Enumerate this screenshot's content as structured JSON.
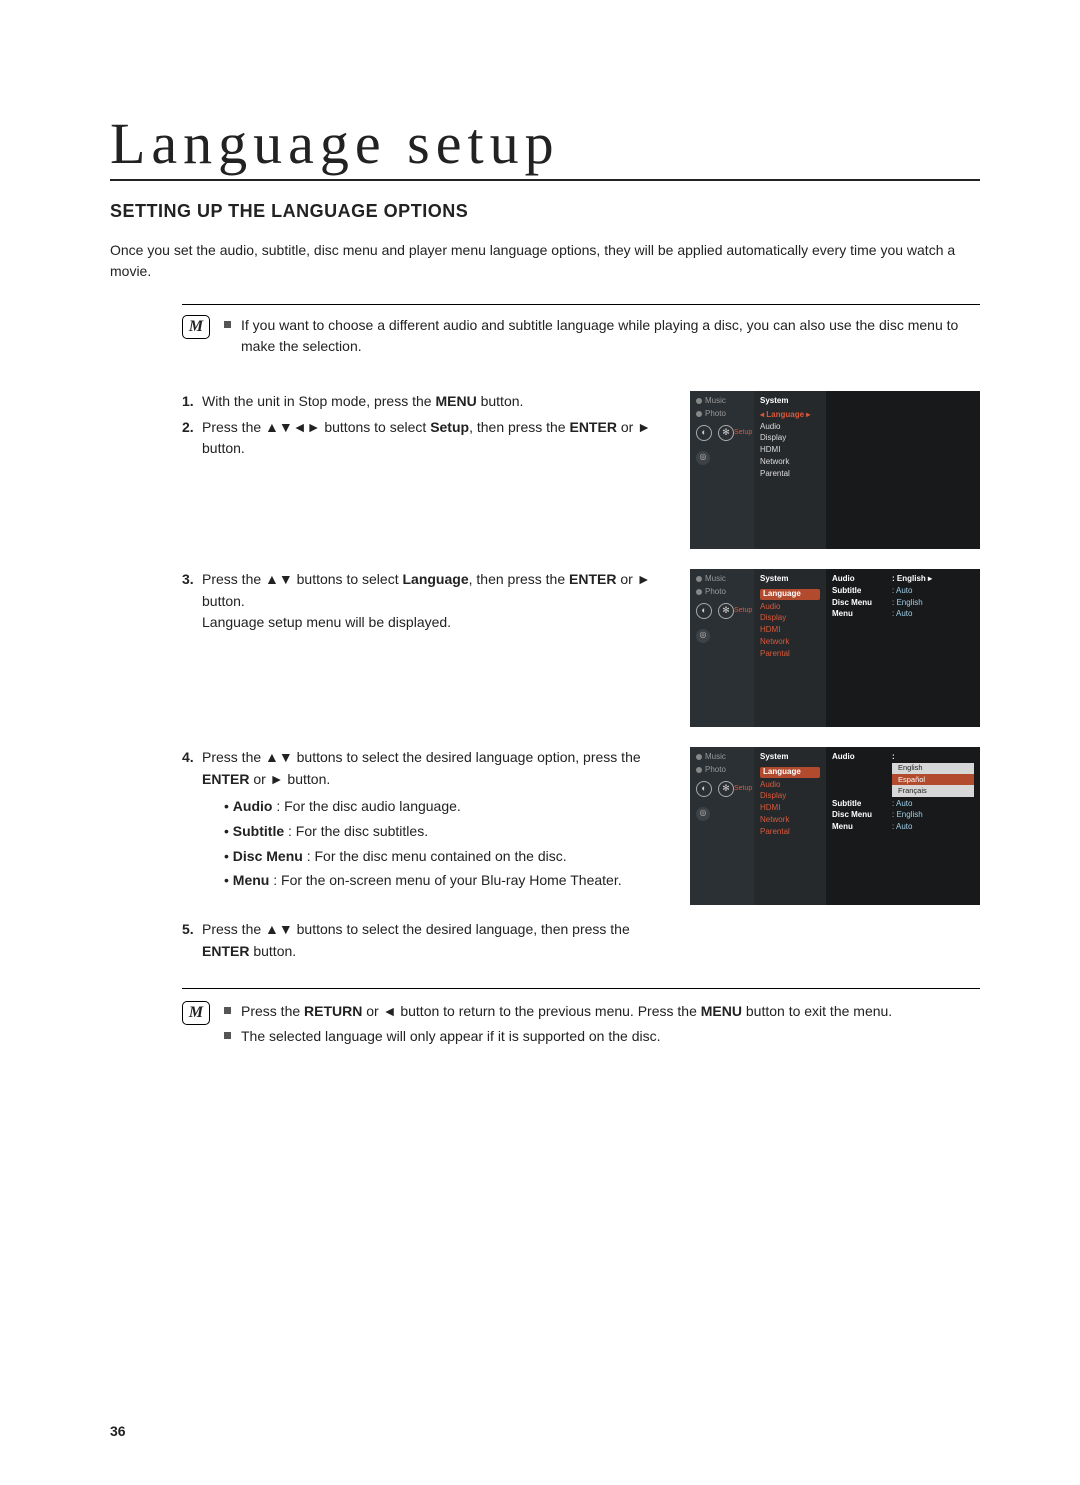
{
  "page_number": "36",
  "chapter_title": "Language setup",
  "section_heading": "SETTING UP THE LANGUAGE OPTIONS",
  "intro": "Once you set the audio, subtitle, disc menu and player menu language options, they will be applied automatically every time you watch a movie.",
  "note_top": {
    "icon_label": "M",
    "items": [
      "If you want to choose a different audio and subtitle language while playing a disc, you can also use the disc menu to make the selection."
    ]
  },
  "steps": {
    "s1": {
      "num": "1.",
      "pre": "With the unit in Stop mode, press the ",
      "b1": "MENU",
      "post": " button."
    },
    "s2": {
      "num": "2.",
      "pre": "Press the ▲▼◄► buttons to select ",
      "b1": "Setup",
      "mid": ", then press the ",
      "b2": "ENTER",
      "post": " or ► button."
    },
    "s3": {
      "num": "3.",
      "pre": "Press the ▲▼ buttons to select ",
      "b1": "Language",
      "mid": ", then press the ",
      "b2": "ENTER",
      "post": " or ► button.",
      "line2": "Language setup menu will be displayed."
    },
    "s4": {
      "num": "4.",
      "line1_pre": "Press the ▲▼ buttons to select the desired language option, press the ",
      "line1_b1": "ENTER",
      "line1_post": " or ► button.",
      "bullets": [
        {
          "b": "Audio",
          "t": " : For the disc audio language."
        },
        {
          "b": "Subtitle",
          "t": " : For the disc subtitles."
        },
        {
          "b": "Disc Menu",
          "t": " : For the disc menu contained on the disc."
        },
        {
          "b": "Menu",
          "t": " : For the on-screen menu of your Blu-ray Home Theater."
        }
      ]
    },
    "s5": {
      "num": "5.",
      "pre": "Press the ▲▼ buttons to select the desired language, then press the ",
      "b1": "ENTER",
      "post": " button."
    }
  },
  "note_bottom": {
    "icon_label": "M",
    "items": [
      {
        "pre": "Press the ",
        "b1": "RETURN",
        "mid": " or ◄ button to return to the previous menu. Press the ",
        "b2": "MENU",
        "post": " button to exit the menu."
      },
      {
        "text": "The selected language will only appear if it is supported on the disc."
      }
    ]
  },
  "osd": {
    "leftnav": {
      "music": "Music",
      "photo": "Photo",
      "setup": "Setup"
    },
    "setup_menu": {
      "header": "System",
      "items": [
        "Language",
        "Audio",
        "Display",
        "HDMI",
        "Network",
        "Parental"
      ]
    },
    "screen1": {
      "highlighted": "Language"
    },
    "screen2": {
      "highlighted": "Language",
      "rows": [
        {
          "k": "Audio",
          "v": "English",
          "sel": true
        },
        {
          "k": "Subtitle",
          "v": "Auto"
        },
        {
          "k": "Disc Menu",
          "v": "English"
        },
        {
          "k": "Menu",
          "v": "Auto"
        }
      ]
    },
    "screen3": {
      "highlighted": "Language",
      "rows": [
        {
          "k": "Audio",
          "v": "",
          "sel": true,
          "dropdown": [
            "English",
            "Español",
            "Français"
          ]
        },
        {
          "k": "Subtitle",
          "v": "Auto"
        },
        {
          "k": "Disc Menu",
          "v": "English"
        },
        {
          "k": "Menu",
          "v": "Auto"
        }
      ]
    }
  }
}
